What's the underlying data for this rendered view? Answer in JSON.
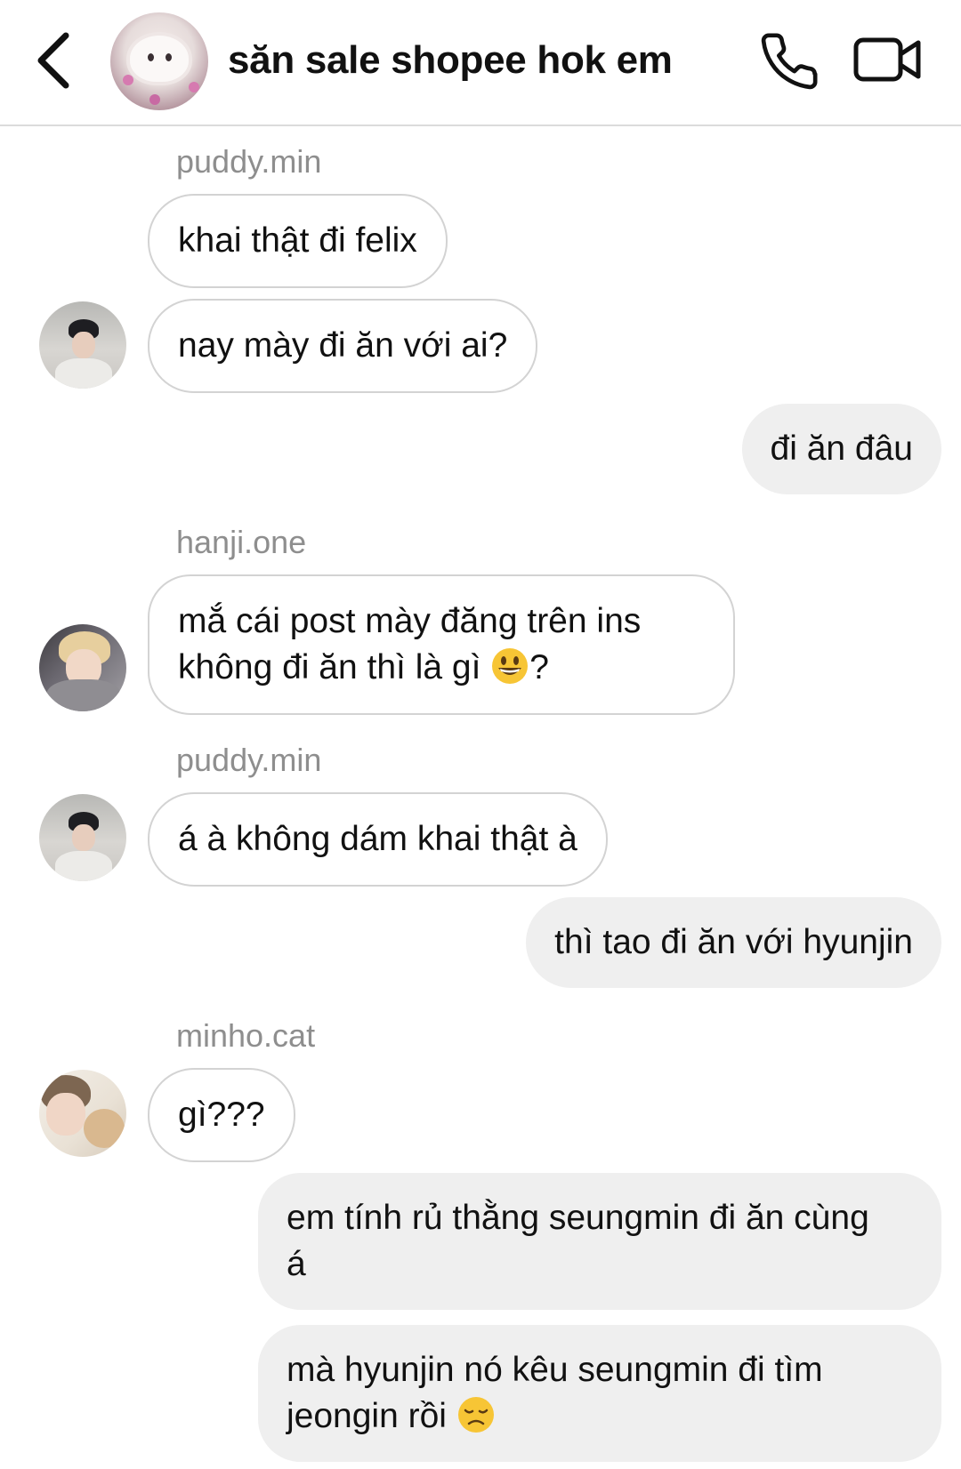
{
  "header": {
    "group_title": "săn sale shopee hok em"
  },
  "messages": [
    {
      "sender": "puddy.min",
      "text": "khai thật đi felix"
    },
    {
      "text": "nay mày đi ăn với ai?"
    },
    {
      "text": "đi ăn đâu"
    },
    {
      "sender": "hanji.one",
      "line1": "mắ cái post mày đăng trên ins",
      "line2": "không đi ăn thì là gì",
      "after_emoji": "?",
      "emoji": "grinning-face-emoji"
    },
    {
      "sender": "puddy.min",
      "text": "á à không dám khai thật à"
    },
    {
      "text": "thì tao đi ăn với hyunjin"
    },
    {
      "sender": "minho.cat",
      "text": "gì???"
    },
    {
      "line1": "em tính rủ thằng seungmin đi ăn cùng",
      "line2": "á"
    },
    {
      "line1": "mà hyunjin nó kêu seungmin đi tìm",
      "line2": "jeongin rồi",
      "emoji": "disappointed-face-emoji"
    }
  ],
  "icons": {
    "back": "chevron-left-icon",
    "call": "phone-icon",
    "video": "video-camera-icon"
  }
}
